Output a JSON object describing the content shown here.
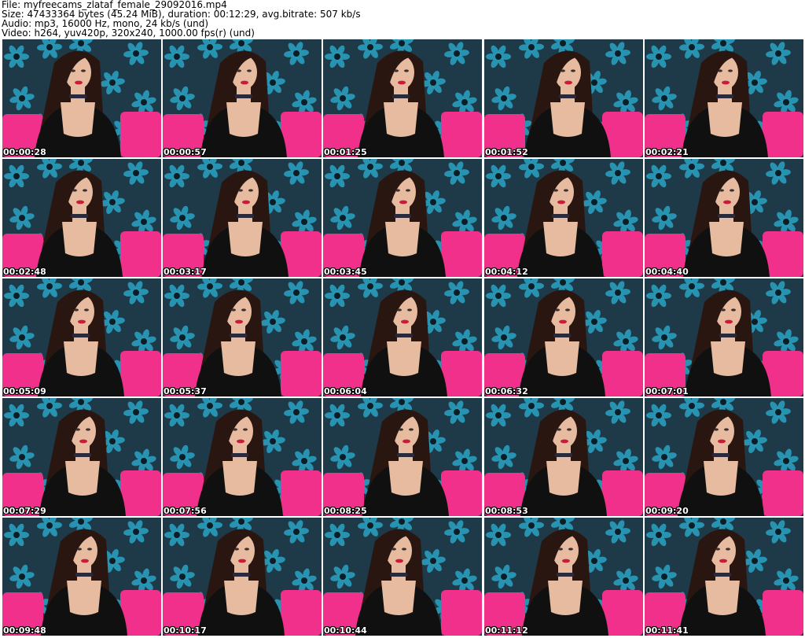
{
  "header": {
    "file": "File: myfreecams_zlataf_female_29092016.mp4",
    "size": "Size: 47433364 bytes (45.24 MiB), duration: 00:12:29, avg.bitrate: 507 kb/s",
    "audio": "Audio: mp3, 16000 Hz, mono, 24 kb/s (und)",
    "video": "Video: h264, yuv420p, 320x240, 1000.00 fps(r) (und)"
  },
  "colors": {
    "wallpaper": "#1e3a48",
    "pattern": "#2aa3c4",
    "sofa": "#f0308a",
    "hair": "#2a1610",
    "skin": "#e6bba0",
    "top": "#101010",
    "lips": "#c81c3a",
    "timestamp": "#ffffff"
  },
  "thumbnails": [
    {
      "time": "00:00:28",
      "icon": "video-frame-thumbnail"
    },
    {
      "time": "00:00:57",
      "icon": "video-frame-thumbnail"
    },
    {
      "time": "00:01:25",
      "icon": "video-frame-thumbnail"
    },
    {
      "time": "00:01:52",
      "icon": "video-frame-thumbnail"
    },
    {
      "time": "00:02:21",
      "icon": "video-frame-thumbnail"
    },
    {
      "time": "00:02:48",
      "icon": "video-frame-thumbnail"
    },
    {
      "time": "00:03:17",
      "icon": "video-frame-thumbnail"
    },
    {
      "time": "00:03:45",
      "icon": "video-frame-thumbnail"
    },
    {
      "time": "00:04:12",
      "icon": "video-frame-thumbnail"
    },
    {
      "time": "00:04:40",
      "icon": "video-frame-thumbnail"
    },
    {
      "time": "00:05:09",
      "icon": "video-frame-thumbnail"
    },
    {
      "time": "00:05:37",
      "icon": "video-frame-thumbnail"
    },
    {
      "time": "00:06:04",
      "icon": "video-frame-thumbnail"
    },
    {
      "time": "00:06:32",
      "icon": "video-frame-thumbnail"
    },
    {
      "time": "00:07:01",
      "icon": "video-frame-thumbnail"
    },
    {
      "time": "00:07:29",
      "icon": "video-frame-thumbnail"
    },
    {
      "time": "00:07:56",
      "icon": "video-frame-thumbnail"
    },
    {
      "time": "00:08:25",
      "icon": "video-frame-thumbnail"
    },
    {
      "time": "00:08:53",
      "icon": "video-frame-thumbnail"
    },
    {
      "time": "00:09:20",
      "icon": "video-frame-thumbnail"
    },
    {
      "time": "00:09:48",
      "icon": "video-frame-thumbnail"
    },
    {
      "time": "00:10:17",
      "icon": "video-frame-thumbnail"
    },
    {
      "time": "00:10:44",
      "icon": "video-frame-thumbnail"
    },
    {
      "time": "00:11:12",
      "icon": "video-frame-thumbnail"
    },
    {
      "time": "00:11:41",
      "icon": "video-frame-thumbnail"
    }
  ]
}
